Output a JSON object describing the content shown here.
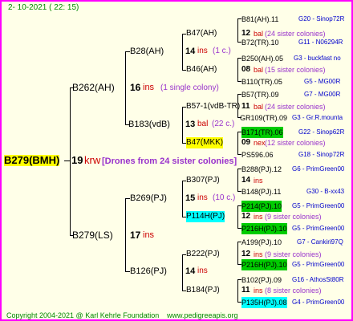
{
  "header": {
    "date": "2- 10-2021 ( 22: 15)"
  },
  "root": {
    "id": "B279(BMH)",
    "num": "19",
    "ins": "krw",
    "drones": "[Drones from 24 sister colonies]"
  },
  "g1": [
    {
      "id": "B262(AH)",
      "num": "16",
      "ins": "ins",
      "note": "(1 single colony)"
    },
    {
      "id": "B279(LS)",
      "num": "17",
      "ins": "ins"
    }
  ],
  "g2": [
    {
      "id": "B28(AH)",
      "num": "14",
      "ins": "ins",
      "note": "(1 c.)"
    },
    {
      "id": "B183(vdB)",
      "num": "13",
      "ins": "bal",
      "note": "(22 c.)"
    },
    {
      "id": "B269(PJ)",
      "num": "15",
      "ins": "ins",
      "note": "(10 c.)"
    },
    {
      "id": "B126(PJ)",
      "num": "14",
      "ins": "ins"
    }
  ],
  "g3": [
    {
      "id": "B47(AH)",
      "num": "12",
      "ins": "bal",
      "note": "(24 sister colonies)"
    },
    {
      "id": "B46(AH)",
      "num": "08",
      "ins": "bal",
      "note": "(15 sister colonies)"
    },
    {
      "id": "B57-1(vdB-TR)",
      "num": "11",
      "ins": "bal",
      "note": "(24 sister colonies)"
    },
    {
      "id": "B47(MKK)",
      "num": "09",
      "ins": "nex",
      "note": "(12 sister colonies)"
    },
    {
      "id": "B307(PJ)",
      "num": "14",
      "ins": "ins"
    },
    {
      "id": "P114H(PJ)",
      "num": "12",
      "ins": "ins",
      "note": "(9 sister colonies)"
    },
    {
      "id": "B222(PJ)",
      "num": "12",
      "ins": "ins",
      "note": "(9 sister colonies)"
    },
    {
      "id": "B184(PJ)",
      "num": "11",
      "ins": "ins",
      "note": "(8 sister colonies)"
    }
  ],
  "g4": [
    {
      "id": "B81(AH).11",
      "info": "G20 - Sinop72R"
    },
    {
      "id": "B72(TR).10",
      "info": "G11 - N06294R"
    },
    {
      "id": "B250(AH).05",
      "info": "G3 - buckfast no"
    },
    {
      "id": "B110(TR).05",
      "info": "G5 - MG00R"
    },
    {
      "id": "B57(TR).09",
      "info": "G7 - MG00R"
    },
    {
      "id": "GR109(TR).09",
      "info": "G3 - Gr.R.mounta"
    },
    {
      "id": "B171(TR).06",
      "info": "G22 - Sinop62R"
    },
    {
      "id": "PS596.06",
      "info": "G18 - Sinop72R"
    },
    {
      "id": "B288(PJ).12",
      "info": "G6 - PrimGreen00"
    },
    {
      "id": "B148(PJ).11",
      "info": "G30 - B-xx43"
    },
    {
      "id": "P214(PJ).10",
      "info": "G5 - PrimGreen00"
    },
    {
      "id": "P216H(PJ).10",
      "info": "G5 - PrimGreen00"
    },
    {
      "id": "A199(PJ).10",
      "info": "G7 - Cankiri97Q"
    },
    {
      "id": "P216H(PJ).10",
      "info": "G5 - PrimGreen00"
    },
    {
      "id": "B102(PJ).09",
      "info": "G16 - AthosSt80R"
    },
    {
      "id": "P135H(PJ).08",
      "info": "G4 - PrimGreen00"
    }
  ],
  "footer": {
    "copyright": "Copyright 2004-2021 @ Karl Kehrle Foundation",
    "site": "www.pedigreeapis.org"
  }
}
